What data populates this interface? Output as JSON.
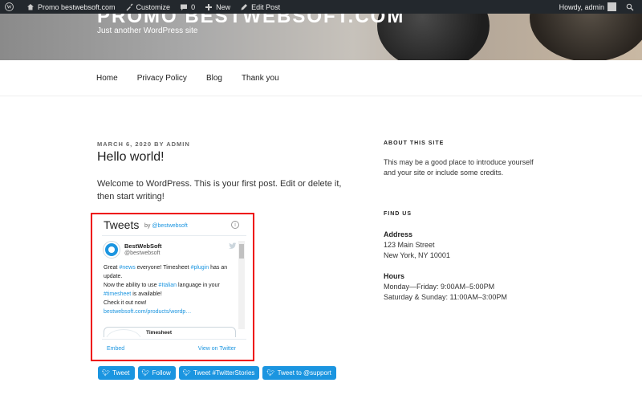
{
  "adminbar": {
    "site_name": "Promo bestwebsoft.com",
    "customize": "Customize",
    "comments": "0",
    "new": "New",
    "edit_post": "Edit Post",
    "howdy": "Howdy, admin"
  },
  "header": {
    "site_title": "PROMO BESTWEBSOFT.COM",
    "tagline": "Just another WordPress site"
  },
  "nav": {
    "items": [
      "Home",
      "Privacy Policy",
      "Blog",
      "Thank you"
    ]
  },
  "post": {
    "meta": "MARCH 6, 2020 BY ADMIN",
    "title": "Hello world!",
    "body": "Welcome to WordPress. This is your first post. Edit or delete it, then start writing!"
  },
  "tweets_widget": {
    "heading": "Tweets",
    "by_prefix": "by",
    "by_handle": "@bestwebsoft",
    "tweet": {
      "name": "BestWebSoft",
      "handle": "@bestwebsoft",
      "line1_a": "Great ",
      "line1_tag1": "#news",
      "line1_b": " everyone! Timesheet ",
      "line1_tag2": "#plugin",
      "line1_c": " has an update.",
      "line2_a": "Now the ability to use ",
      "line2_tag": "#Italian",
      "line2_b": " language in your",
      "line3_tag": "#timesheet",
      "line3_b": " is available!",
      "line4": "Check it out now!",
      "link": "bestwebsoft.com/products/wordp…",
      "quote_title": "Timesheet"
    },
    "embed": "Embed",
    "view": "View on Twitter"
  },
  "buttons": [
    "Tweet",
    "Follow",
    "Tweet #TwitterStories",
    "Tweet to @support"
  ],
  "sidebar": {
    "about_heading": "ABOUT THIS SITE",
    "about_text": "This may be a good place to introduce yourself and your site or include some credits.",
    "find_heading": "FIND US",
    "address_label": "Address",
    "address_line1": "123 Main Street",
    "address_line2": "New York, NY 10001",
    "hours_label": "Hours",
    "hours_line1": "Monday—Friday: 9:00AM–5:00PM",
    "hours_line2": "Saturday & Sunday: 11:00AM–3:00PM"
  },
  "colors": {
    "adminbar_bg": "#23282d",
    "twitter_blue": "#1b95e0",
    "highlight_border": "#ee0000"
  }
}
